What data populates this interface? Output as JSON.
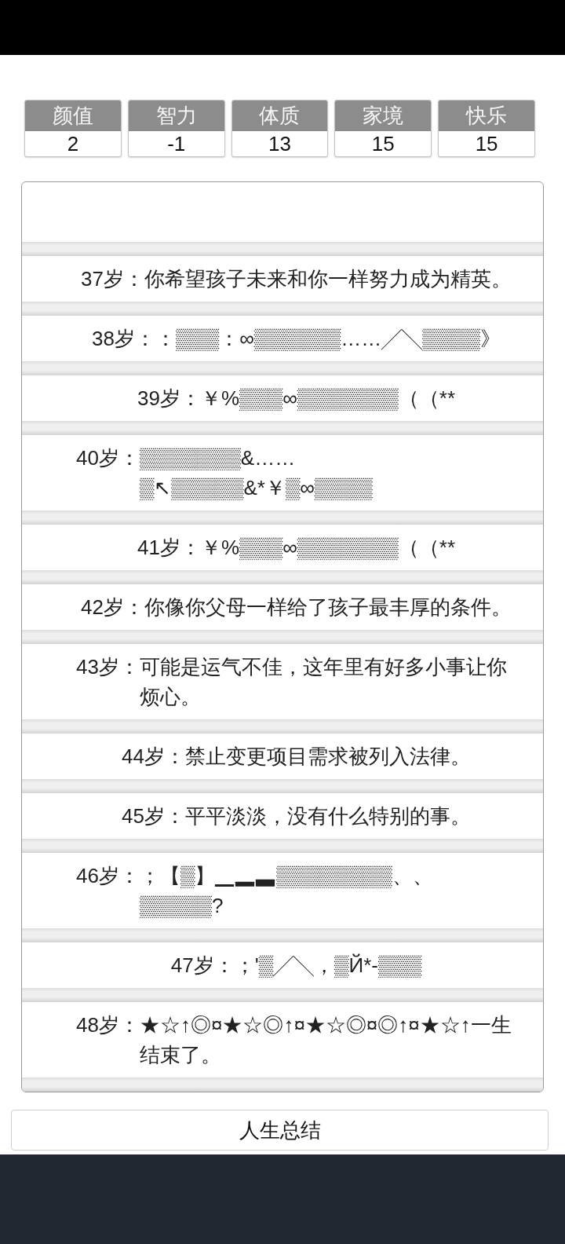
{
  "stats": [
    {
      "label": "颜值",
      "value": "2"
    },
    {
      "label": "智力",
      "value": "-1"
    },
    {
      "label": "体质",
      "value": "13"
    },
    {
      "label": "家境",
      "value": "15"
    },
    {
      "label": "快乐",
      "value": "15"
    }
  ],
  "events": [
    {
      "age": "37岁：",
      "text": "你希望孩子未来和你一样努力成为精英。"
    },
    {
      "age": "38岁：",
      "text": "：▒▒▒：∞▒▒▒▒▒▒……╱╲▒▒▒▒》"
    },
    {
      "age": "39岁：",
      "text": "￥%▒▒▒∞▒▒▒▒▒▒▒（（**"
    },
    {
      "age": "40岁：",
      "text": "▒▒▒▒▒▒▒&……▒↖▒▒▒▒▒&*￥▒∞▒▒▒▒"
    },
    {
      "age": "41岁：",
      "text": "￥%▒▒▒∞▒▒▒▒▒▒▒（（**"
    },
    {
      "age": "42岁：",
      "text": "你像你父母一样给了孩子最丰厚的条件。"
    },
    {
      "age": "43岁：",
      "text": "可能是运气不佳，这年里有好多小事让你烦心。"
    },
    {
      "age": "44岁：",
      "text": "禁止变更项目需求被列入法律。"
    },
    {
      "age": "45岁：",
      "text": "平平淡淡，没有什么特别的事。"
    },
    {
      "age": "46岁：",
      "text": "；【▒】▁▂▃▒▒▒▒▒▒▒▒、、▒▒▒▒▒?"
    },
    {
      "age": "47岁：",
      "text": "；'▒╱╲，▒Й*-▒▒▒"
    },
    {
      "age": "48岁：",
      "text": "★☆↑◎¤★☆◎↑¤★☆◎¤◎↑¤★☆↑一生结束了。"
    }
  ],
  "summary_button": {
    "label": "人生总结"
  }
}
